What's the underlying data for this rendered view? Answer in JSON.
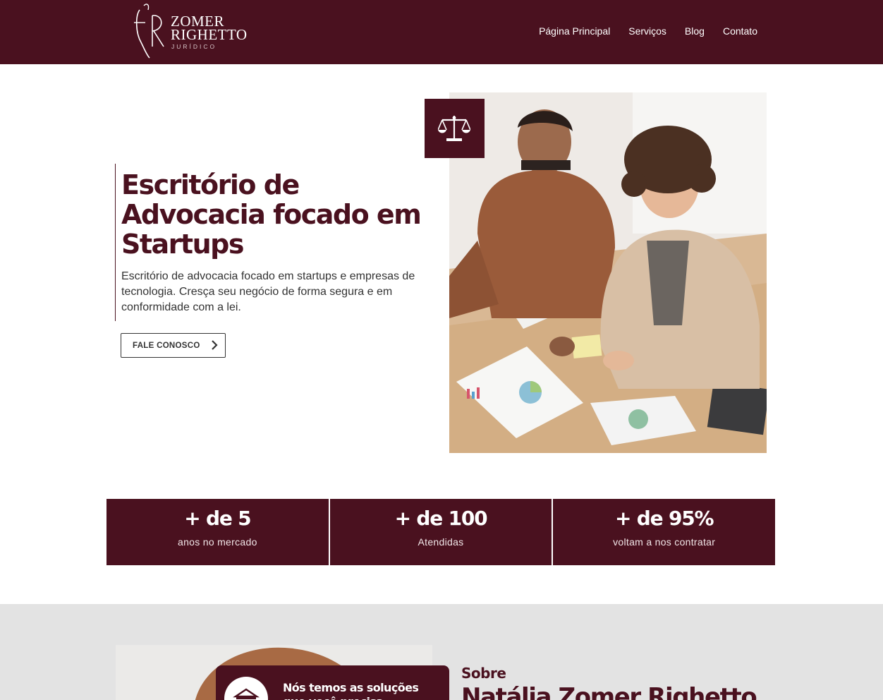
{
  "brand": {
    "name_line1": "ZOMER",
    "name_line2": "RIGHETTO",
    "tagline": "JURÍDICO",
    "colors": {
      "primary": "#4a111f",
      "background": "#ffffff",
      "section_gray": "#e3e3e3"
    }
  },
  "nav": {
    "items": [
      {
        "label": "Página Principal"
      },
      {
        "label": "Serviços"
      },
      {
        "label": "Blog"
      },
      {
        "label": "Contato"
      }
    ]
  },
  "hero": {
    "title": "Escritório de Advocacia focado em Startups",
    "description": "Escritório de advocacia focado em startups e empresas de tecnologia. Cresça seu negócio de forma segura e em conformidade com a lei.",
    "cta_label": "FALE CONOSCO",
    "cta_icon": "chevron-right-icon",
    "badge_icon": "scales-of-justice-icon",
    "photo": "team-meeting-photo"
  },
  "stats": [
    {
      "value": "+ de 5",
      "label": "anos no mercado"
    },
    {
      "value": "+ de 100",
      "label": "Atendidas"
    },
    {
      "value": "+ de 95%",
      "label": "voltam a nos contratar"
    }
  ],
  "about": {
    "kicker": "Sobre",
    "name": "Natália Zomer Righetto",
    "solutions_text": "Nós temos as soluções que você precisa",
    "solutions_icon": "courthouse-icon"
  }
}
